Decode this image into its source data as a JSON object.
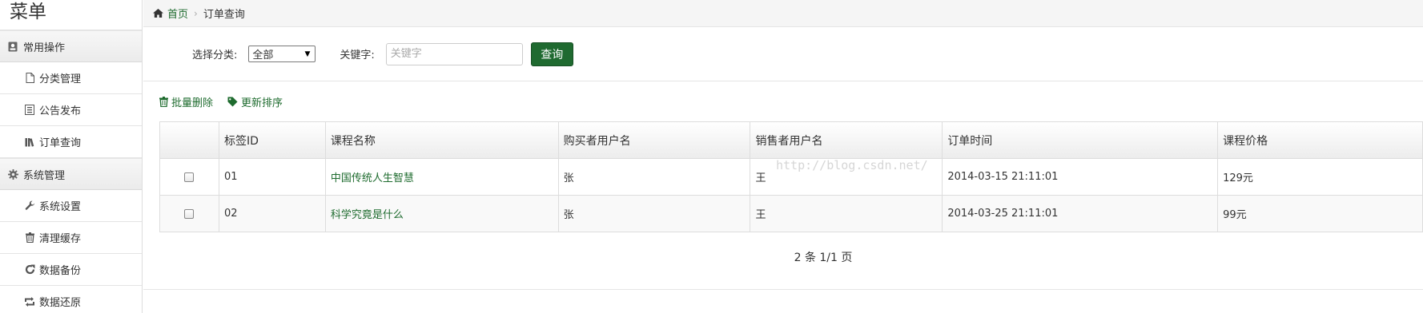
{
  "sidebar": {
    "title": "菜单",
    "groups": [
      {
        "label": "常用操作",
        "items": [
          {
            "label": "分类管理"
          },
          {
            "label": "公告发布"
          },
          {
            "label": "订单查询"
          }
        ]
      },
      {
        "label": "系统管理",
        "items": [
          {
            "label": "系统设置"
          },
          {
            "label": "清理缓存"
          },
          {
            "label": "数据备份"
          },
          {
            "label": "数据还原"
          }
        ]
      }
    ]
  },
  "breadcrumb": {
    "home": "首页",
    "current": "订单查询"
  },
  "filter": {
    "category_label": "选择分类:",
    "category_value": "全部",
    "keyword_label": "关键字:",
    "keyword_placeholder": "关键字",
    "query_button": "查询"
  },
  "toolbar": {
    "batch_delete": "批量删除",
    "update_sort": "更新排序"
  },
  "table": {
    "headers": [
      "",
      "标签ID",
      "课程名称",
      "购买者用户名",
      "销售者用户名",
      "订单时间",
      "课程价格"
    ],
    "rows": [
      {
        "id": "01",
        "course": "中国传统人生智慧",
        "buyer": "张",
        "seller": "王",
        "time": "2014-03-15 21:11:01",
        "price": "129元"
      },
      {
        "id": "02",
        "course": "科学究竟是什么",
        "buyer": "张",
        "seller": "王",
        "time": "2014-03-25 21:11:01",
        "price": "99元"
      }
    ]
  },
  "pager": "2 条 1/1 页",
  "watermark": "http://blog.csdn.net/",
  "colors": {
    "accent": "#1f6a30",
    "link": "#1e6b2e"
  }
}
